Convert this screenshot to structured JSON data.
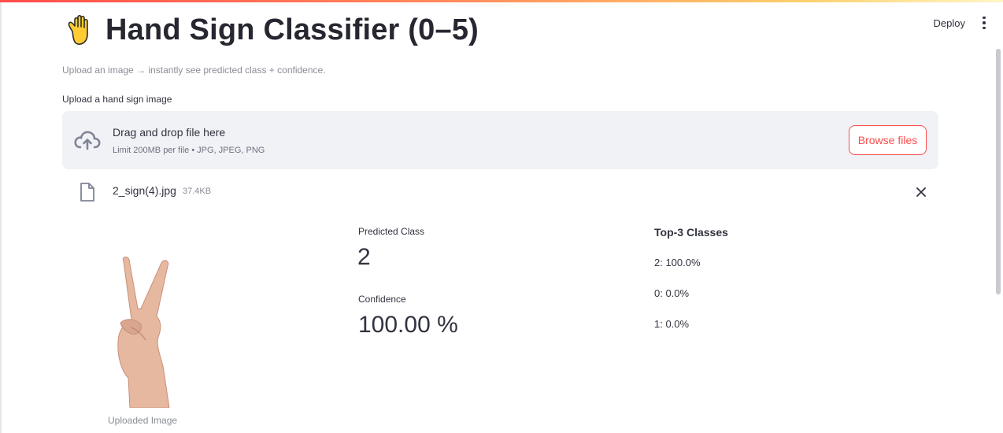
{
  "app": {
    "title": "Hand Sign Classifier (0–5)",
    "title_icon": "raised-hand-emoji",
    "subtitle": "Upload an image → instantly see predicted class + confidence.",
    "accent_color": "#ff4b4b"
  },
  "header": {
    "deploy_label": "Deploy",
    "menu_icon": "more-vertical-icon"
  },
  "uploader": {
    "label": "Upload a hand sign image",
    "drop_title": "Drag and drop file here",
    "drop_subtitle": "Limit 200MB per file • JPG, JPEG, PNG",
    "browse_label": "Browse files",
    "icon": "cloud-upload-icon"
  },
  "file": {
    "name": "2_sign(4).jpg",
    "size": "37.4KB",
    "icon": "file-icon",
    "remove_icon": "close-icon"
  },
  "image": {
    "caption": "Uploaded Image",
    "content": "hand-victory-sign"
  },
  "results": {
    "predicted_label": "Predicted Class",
    "predicted_value": "2",
    "confidence_label": "Confidence",
    "confidence_value": "100.00 %"
  },
  "top3": {
    "title": "Top-3 Classes",
    "items": [
      "2: 100.0%",
      "0: 0.0%",
      "1: 0.0%"
    ]
  }
}
